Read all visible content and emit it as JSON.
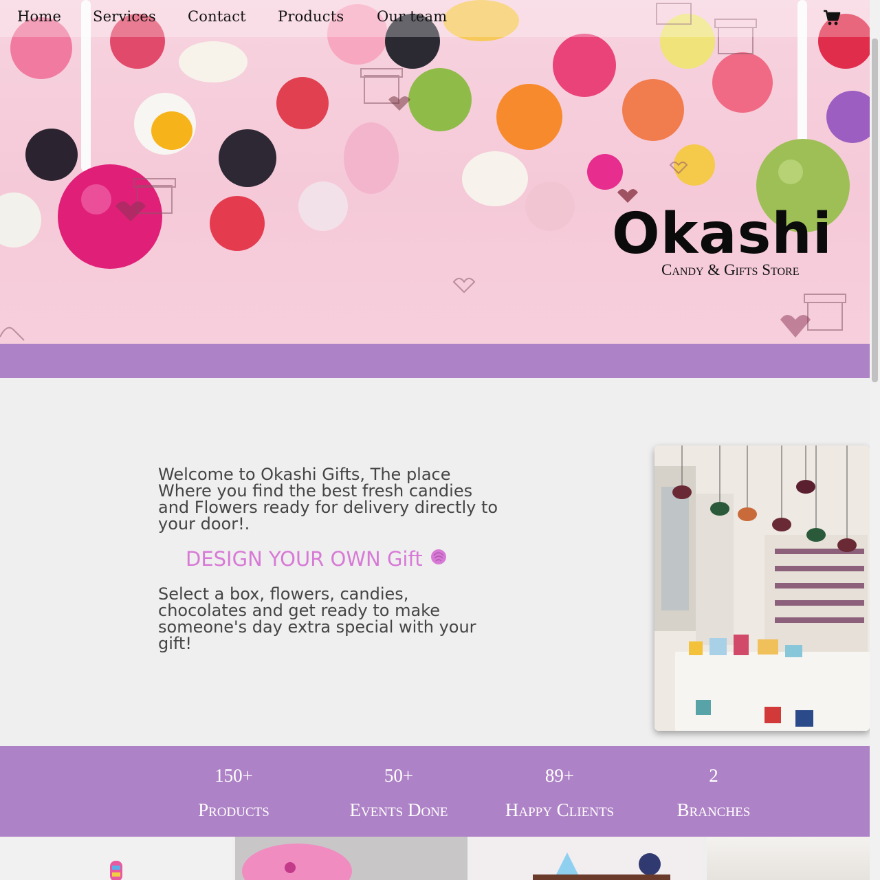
{
  "nav": {
    "items": [
      {
        "label": "Home"
      },
      {
        "label": "Services"
      },
      {
        "label": "Contact"
      },
      {
        "label": "Products"
      },
      {
        "label": "Our team"
      }
    ],
    "cart_icon": "shopping-cart-icon"
  },
  "hero": {
    "brand_name": "Okashi",
    "brand_tagline": "Candy & Gifts Store"
  },
  "welcome": {
    "intro": "Welcome to Okashi Gifts, The place Where you find the best fresh candies and Flowers ready for delivery directly to your door!.",
    "design_cta": "DESIGN YOUR OWN Gift",
    "design_icon": "rose-icon",
    "description": "Select a box, flowers, candies, chocolates and get ready to make someone's day extra special with your gift!"
  },
  "stats": [
    {
      "value": "150+",
      "label": "Products"
    },
    {
      "value": "50+",
      "label": "Events Done"
    },
    {
      "value": "89+",
      "label": "Happy Clients"
    },
    {
      "value": "2",
      "label": "Branches"
    }
  ],
  "colors": {
    "band": "#ae82c6",
    "accent": "#d77ad6",
    "text": "#444444"
  }
}
